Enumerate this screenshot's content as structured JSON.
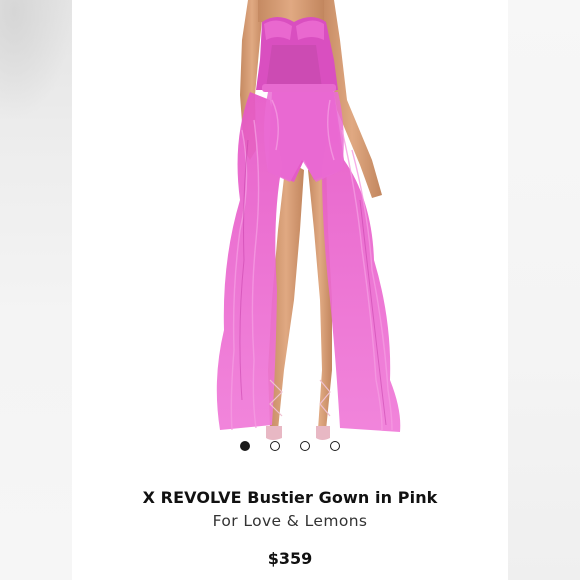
{
  "product": {
    "title": "X REVOLVE Bustier Gown in Pink",
    "brand": "For Love & Lemons",
    "price": "$359",
    "image_icon": "pink-tulle-gown-photo"
  },
  "carousel": {
    "total_images": 4,
    "active_index": 0
  },
  "colors": {
    "gown_pink": "#e05cc4",
    "text_dark": "#111111"
  }
}
